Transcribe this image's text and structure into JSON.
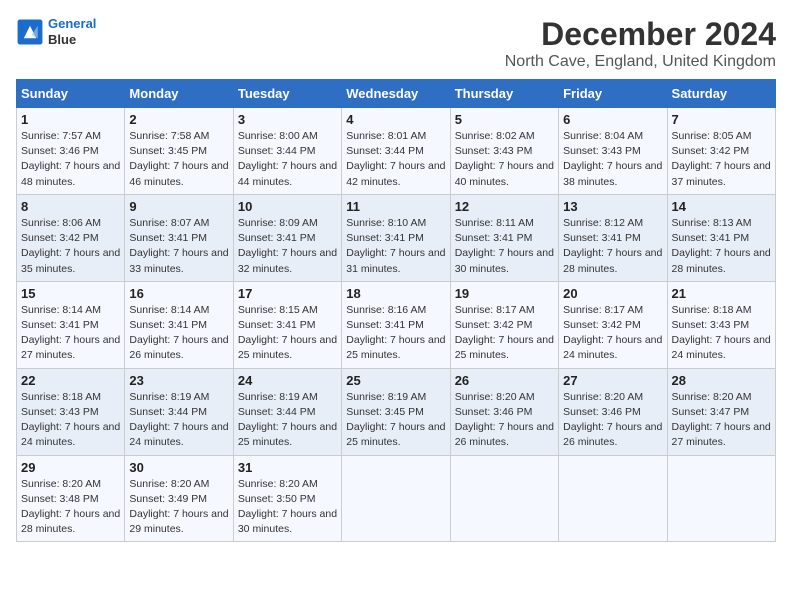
{
  "logo": {
    "line1": "General",
    "line2": "Blue"
  },
  "title": "December 2024",
  "subtitle": "North Cave, England, United Kingdom",
  "days_of_week": [
    "Sunday",
    "Monday",
    "Tuesday",
    "Wednesday",
    "Thursday",
    "Friday",
    "Saturday"
  ],
  "weeks": [
    [
      {
        "day": "1",
        "sunrise": "Sunrise: 7:57 AM",
        "sunset": "Sunset: 3:46 PM",
        "daylight": "Daylight: 7 hours and 48 minutes."
      },
      {
        "day": "2",
        "sunrise": "Sunrise: 7:58 AM",
        "sunset": "Sunset: 3:45 PM",
        "daylight": "Daylight: 7 hours and 46 minutes."
      },
      {
        "day": "3",
        "sunrise": "Sunrise: 8:00 AM",
        "sunset": "Sunset: 3:44 PM",
        "daylight": "Daylight: 7 hours and 44 minutes."
      },
      {
        "day": "4",
        "sunrise": "Sunrise: 8:01 AM",
        "sunset": "Sunset: 3:44 PM",
        "daylight": "Daylight: 7 hours and 42 minutes."
      },
      {
        "day": "5",
        "sunrise": "Sunrise: 8:02 AM",
        "sunset": "Sunset: 3:43 PM",
        "daylight": "Daylight: 7 hours and 40 minutes."
      },
      {
        "day": "6",
        "sunrise": "Sunrise: 8:04 AM",
        "sunset": "Sunset: 3:43 PM",
        "daylight": "Daylight: 7 hours and 38 minutes."
      },
      {
        "day": "7",
        "sunrise": "Sunrise: 8:05 AM",
        "sunset": "Sunset: 3:42 PM",
        "daylight": "Daylight: 7 hours and 37 minutes."
      }
    ],
    [
      {
        "day": "8",
        "sunrise": "Sunrise: 8:06 AM",
        "sunset": "Sunset: 3:42 PM",
        "daylight": "Daylight: 7 hours and 35 minutes."
      },
      {
        "day": "9",
        "sunrise": "Sunrise: 8:07 AM",
        "sunset": "Sunset: 3:41 PM",
        "daylight": "Daylight: 7 hours and 33 minutes."
      },
      {
        "day": "10",
        "sunrise": "Sunrise: 8:09 AM",
        "sunset": "Sunset: 3:41 PM",
        "daylight": "Daylight: 7 hours and 32 minutes."
      },
      {
        "day": "11",
        "sunrise": "Sunrise: 8:10 AM",
        "sunset": "Sunset: 3:41 PM",
        "daylight": "Daylight: 7 hours and 31 minutes."
      },
      {
        "day": "12",
        "sunrise": "Sunrise: 8:11 AM",
        "sunset": "Sunset: 3:41 PM",
        "daylight": "Daylight: 7 hours and 30 minutes."
      },
      {
        "day": "13",
        "sunrise": "Sunrise: 8:12 AM",
        "sunset": "Sunset: 3:41 PM",
        "daylight": "Daylight: 7 hours and 28 minutes."
      },
      {
        "day": "14",
        "sunrise": "Sunrise: 8:13 AM",
        "sunset": "Sunset: 3:41 PM",
        "daylight": "Daylight: 7 hours and 28 minutes."
      }
    ],
    [
      {
        "day": "15",
        "sunrise": "Sunrise: 8:14 AM",
        "sunset": "Sunset: 3:41 PM",
        "daylight": "Daylight: 7 hours and 27 minutes."
      },
      {
        "day": "16",
        "sunrise": "Sunrise: 8:14 AM",
        "sunset": "Sunset: 3:41 PM",
        "daylight": "Daylight: 7 hours and 26 minutes."
      },
      {
        "day": "17",
        "sunrise": "Sunrise: 8:15 AM",
        "sunset": "Sunset: 3:41 PM",
        "daylight": "Daylight: 7 hours and 25 minutes."
      },
      {
        "day": "18",
        "sunrise": "Sunrise: 8:16 AM",
        "sunset": "Sunset: 3:41 PM",
        "daylight": "Daylight: 7 hours and 25 minutes."
      },
      {
        "day": "19",
        "sunrise": "Sunrise: 8:17 AM",
        "sunset": "Sunset: 3:42 PM",
        "daylight": "Daylight: 7 hours and 25 minutes."
      },
      {
        "day": "20",
        "sunrise": "Sunrise: 8:17 AM",
        "sunset": "Sunset: 3:42 PM",
        "daylight": "Daylight: 7 hours and 24 minutes."
      },
      {
        "day": "21",
        "sunrise": "Sunrise: 8:18 AM",
        "sunset": "Sunset: 3:43 PM",
        "daylight": "Daylight: 7 hours and 24 minutes."
      }
    ],
    [
      {
        "day": "22",
        "sunrise": "Sunrise: 8:18 AM",
        "sunset": "Sunset: 3:43 PM",
        "daylight": "Daylight: 7 hours and 24 minutes."
      },
      {
        "day": "23",
        "sunrise": "Sunrise: 8:19 AM",
        "sunset": "Sunset: 3:44 PM",
        "daylight": "Daylight: 7 hours and 24 minutes."
      },
      {
        "day": "24",
        "sunrise": "Sunrise: 8:19 AM",
        "sunset": "Sunset: 3:44 PM",
        "daylight": "Daylight: 7 hours and 25 minutes."
      },
      {
        "day": "25",
        "sunrise": "Sunrise: 8:19 AM",
        "sunset": "Sunset: 3:45 PM",
        "daylight": "Daylight: 7 hours and 25 minutes."
      },
      {
        "day": "26",
        "sunrise": "Sunrise: 8:20 AM",
        "sunset": "Sunset: 3:46 PM",
        "daylight": "Daylight: 7 hours and 26 minutes."
      },
      {
        "day": "27",
        "sunrise": "Sunrise: 8:20 AM",
        "sunset": "Sunset: 3:46 PM",
        "daylight": "Daylight: 7 hours and 26 minutes."
      },
      {
        "day": "28",
        "sunrise": "Sunrise: 8:20 AM",
        "sunset": "Sunset: 3:47 PM",
        "daylight": "Daylight: 7 hours and 27 minutes."
      }
    ],
    [
      {
        "day": "29",
        "sunrise": "Sunrise: 8:20 AM",
        "sunset": "Sunset: 3:48 PM",
        "daylight": "Daylight: 7 hours and 28 minutes."
      },
      {
        "day": "30",
        "sunrise": "Sunrise: 8:20 AM",
        "sunset": "Sunset: 3:49 PM",
        "daylight": "Daylight: 7 hours and 29 minutes."
      },
      {
        "day": "31",
        "sunrise": "Sunrise: 8:20 AM",
        "sunset": "Sunset: 3:50 PM",
        "daylight": "Daylight: 7 hours and 30 minutes."
      },
      null,
      null,
      null,
      null
    ]
  ]
}
